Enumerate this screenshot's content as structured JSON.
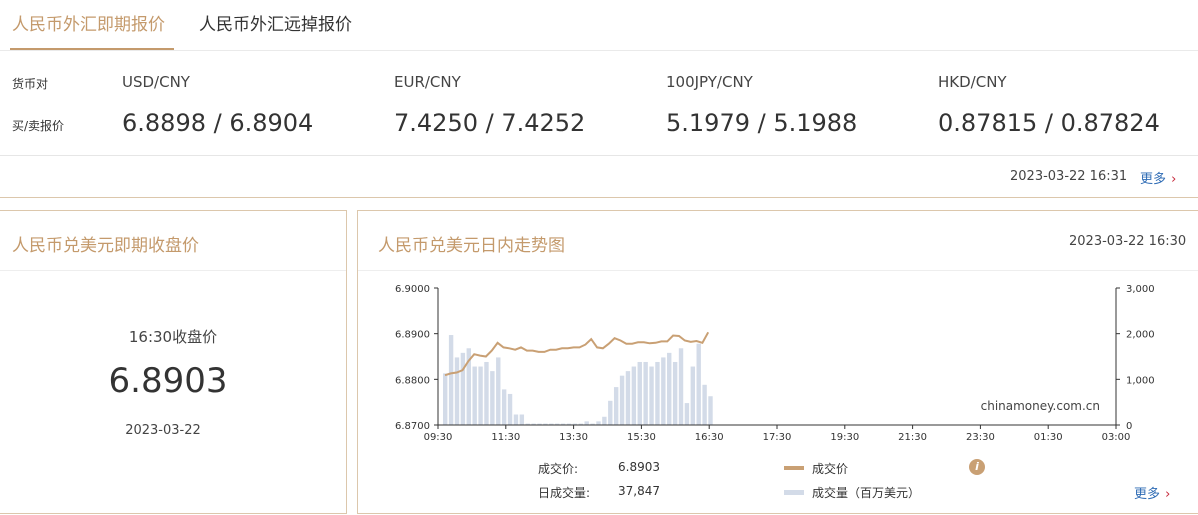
{
  "tabs": [
    {
      "label": "人民币外汇即期报价",
      "active": true
    },
    {
      "label": "人民币外汇远掉报价",
      "active": false
    }
  ],
  "quotes": {
    "pair_label": "货币对",
    "price_label": "买/卖报价",
    "items": [
      {
        "pair": "USD/CNY",
        "price": "6.8898 / 6.8904"
      },
      {
        "pair": "EUR/CNY",
        "price": "7.4250 / 7.4252"
      },
      {
        "pair": "100JPY/CNY",
        "price": "5.1979 / 5.1988"
      },
      {
        "pair": "HKD/CNY",
        "price": "0.87815 / 0.87824"
      }
    ],
    "timestamp": "2023-03-22 16:31",
    "more_label": "更多"
  },
  "closing_panel": {
    "title": "人民币兑美元即期收盘价",
    "close_label": "16:30收盘价",
    "close_value": "6.8903",
    "date": "2023-03-22"
  },
  "intraday_panel": {
    "title": "人民币兑美元日内走势图",
    "timestamp": "2023-03-22 16:30",
    "watermark": "chinamoney.com.cn",
    "price_label": "成交价:",
    "price_value": "6.8903",
    "volume_label": "日成交量:",
    "volume_value": "37,847",
    "legend_price": "成交价",
    "legend_volume": "成交量（百万美元）",
    "more_label": "更多",
    "colors": {
      "price_line": "#c9a074",
      "volume_bar": "#d3dbe8",
      "info_icon": "#c9a074"
    }
  },
  "chart_data": {
    "type": "line",
    "x_ticks": [
      "09:30",
      "11:30",
      "13:30",
      "15:30",
      "16:30",
      "17:30",
      "19:30",
      "21:30",
      "23:30",
      "01:30",
      "03:00"
    ],
    "y_left": {
      "ticks": [
        "6.8700",
        "6.8800",
        "6.8900",
        "6.9000"
      ],
      "range": [
        6.87,
        6.9
      ]
    },
    "y_right": {
      "ticks": [
        "0",
        "1,000",
        "2,000",
        "3,000"
      ],
      "range": [
        0,
        3000
      ]
    },
    "volume_bars": [
      1130,
      1970,
      1480,
      1580,
      1680,
      1280,
      1280,
      1380,
      1180,
      1480,
      780,
      680,
      230,
      230,
      30,
      30,
      30,
      30,
      30,
      30,
      30,
      30,
      30,
      30,
      80,
      30,
      80,
      180,
      530,
      830,
      1080,
      1180,
      1280,
      1380,
      1380,
      1280,
      1380,
      1480,
      1580,
      1380,
      1680,
      480,
      1280,
      1780,
      880,
      630
    ],
    "price_line": [
      6.8809,
      6.8813,
      6.8815,
      6.882,
      6.884,
      6.8855,
      6.8852,
      6.885,
      6.8863,
      6.888,
      6.887,
      6.8868,
      6.8865,
      6.887,
      6.8863,
      6.8863,
      6.886,
      6.886,
      6.8865,
      6.8865,
      6.8868,
      6.8868,
      6.887,
      6.887,
      6.8876,
      6.8888,
      6.887,
      6.8868,
      6.8878,
      6.889,
      6.8885,
      6.8878,
      6.8878,
      6.8881,
      6.8881,
      6.8879,
      6.888,
      6.8883,
      6.8883,
      6.8896,
      6.8895,
      6.8885,
      6.8882,
      6.8884,
      6.888,
      6.8903
    ]
  }
}
